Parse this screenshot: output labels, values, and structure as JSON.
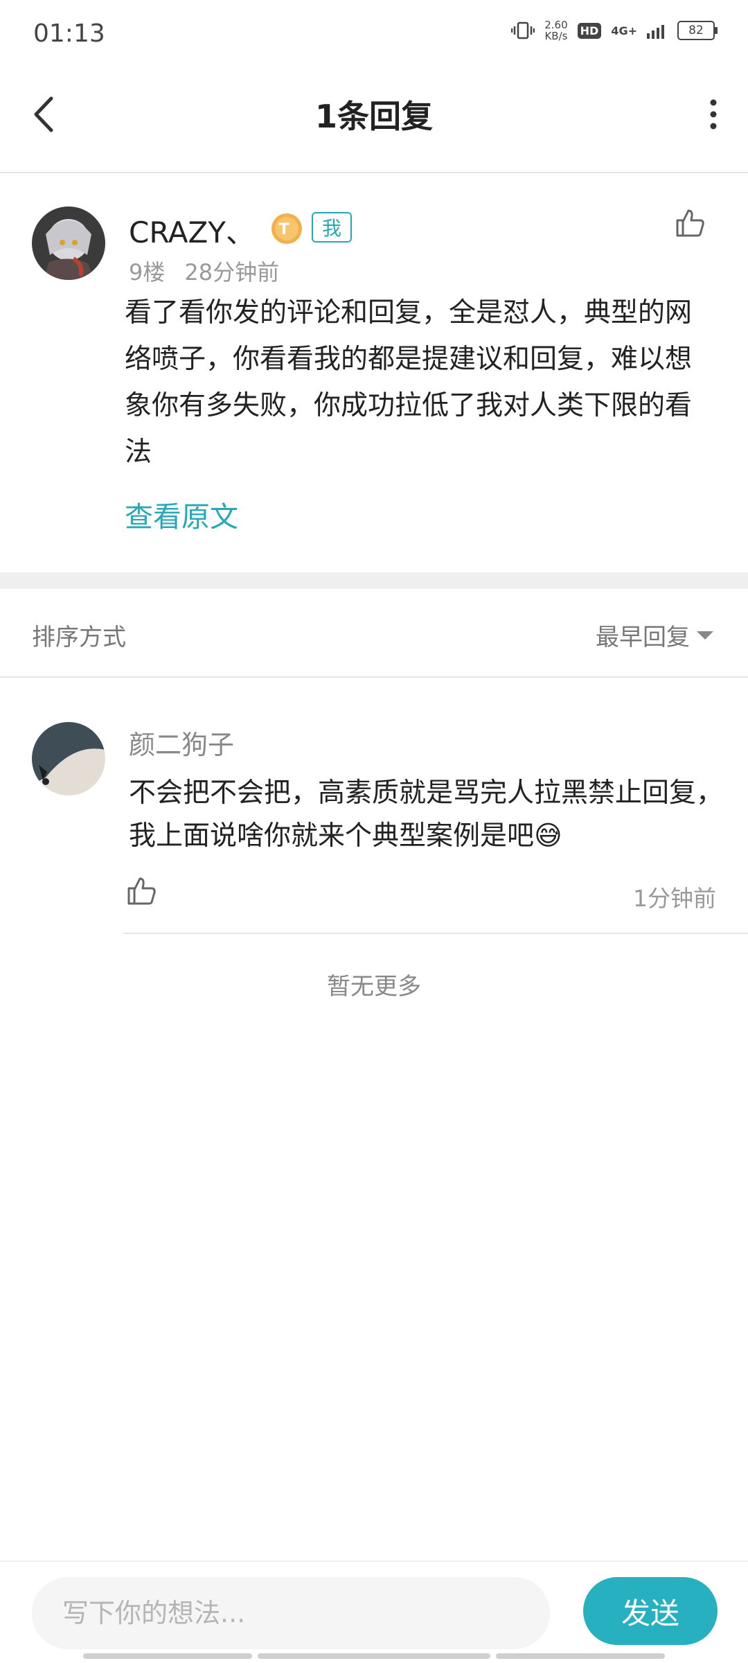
{
  "status_bar": {
    "time": "01:13",
    "speed_value": "2.60",
    "speed_unit": "KB/s",
    "hd": "HD",
    "network": "4G+",
    "battery": "82"
  },
  "header": {
    "title": "1条回复",
    "back_icon": "chevron-left-icon",
    "more_icon": "more-vertical-icon"
  },
  "comment": {
    "user_name": "CRAZY、",
    "level_badge": "T",
    "me_badge": "我",
    "floor": "9楼",
    "time_ago": "28分钟前",
    "text": "看了看你发的评论和回复，全是怼人，典型的网络喷子，你看看我的都是提建议和回复，难以想象你有多失败，你成功拉低了我对人类下限的看法",
    "view_original": "查看原文"
  },
  "sort": {
    "label": "排序方式",
    "value": "最早回复"
  },
  "reply": {
    "user_name": "颜二狗子",
    "text": "不会把不会把，高素质就是骂完人拉黑禁止回复，我上面说啥你就来个典型案例是吧😅",
    "time_ago": "1分钟前"
  },
  "no_more": "暂无更多",
  "composer": {
    "placeholder": "写下你的想法...",
    "send_label": "发送"
  },
  "colors": {
    "accent": "#27b1c0",
    "link": "#27a9b5"
  }
}
